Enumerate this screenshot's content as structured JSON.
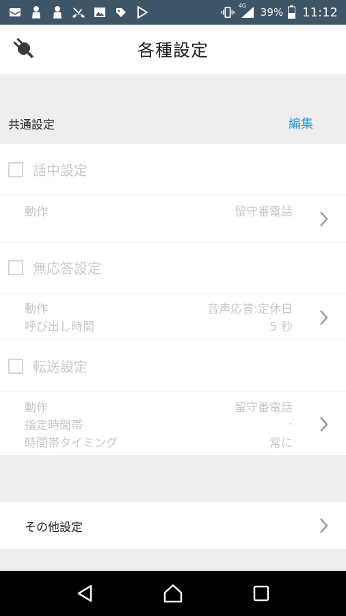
{
  "status_bar": {
    "network_label": "4G",
    "battery": "39%",
    "time": "11:12",
    "left_icons": [
      "mail-icon",
      "person-icon",
      "person-icon",
      "missed-call-icon",
      "image-icon",
      "map-pin-icon",
      "play-store-icon"
    ],
    "right_icons": [
      "vibrate-icon",
      "signal-icon",
      "battery-icon"
    ]
  },
  "header": {
    "title": "各種設定",
    "logo_icon": "plug-icon"
  },
  "common": {
    "label": "共通設定",
    "edit_label": "編集",
    "edit_color": "#2a9fd6"
  },
  "busy": {
    "label": "話中設定",
    "rows": [
      {
        "key": "動作",
        "value": "留守番電話"
      }
    ]
  },
  "no_answer": {
    "label": "無応答設定",
    "rows": [
      {
        "key": "動作",
        "value": "音声応答:定休日"
      },
      {
        "key": "呼び出し時間",
        "value": "5 秒"
      }
    ]
  },
  "forward": {
    "label": "転送設定",
    "rows": [
      {
        "key": "動作",
        "value": "留守番電話"
      },
      {
        "key": "指定時間帯",
        "value": "-"
      },
      {
        "key": "時間帯タイミング",
        "value": "常に"
      }
    ]
  },
  "other": {
    "label": "その他設定"
  },
  "nav": {
    "icons": [
      "back-icon",
      "home-icon",
      "recents-icon"
    ]
  }
}
